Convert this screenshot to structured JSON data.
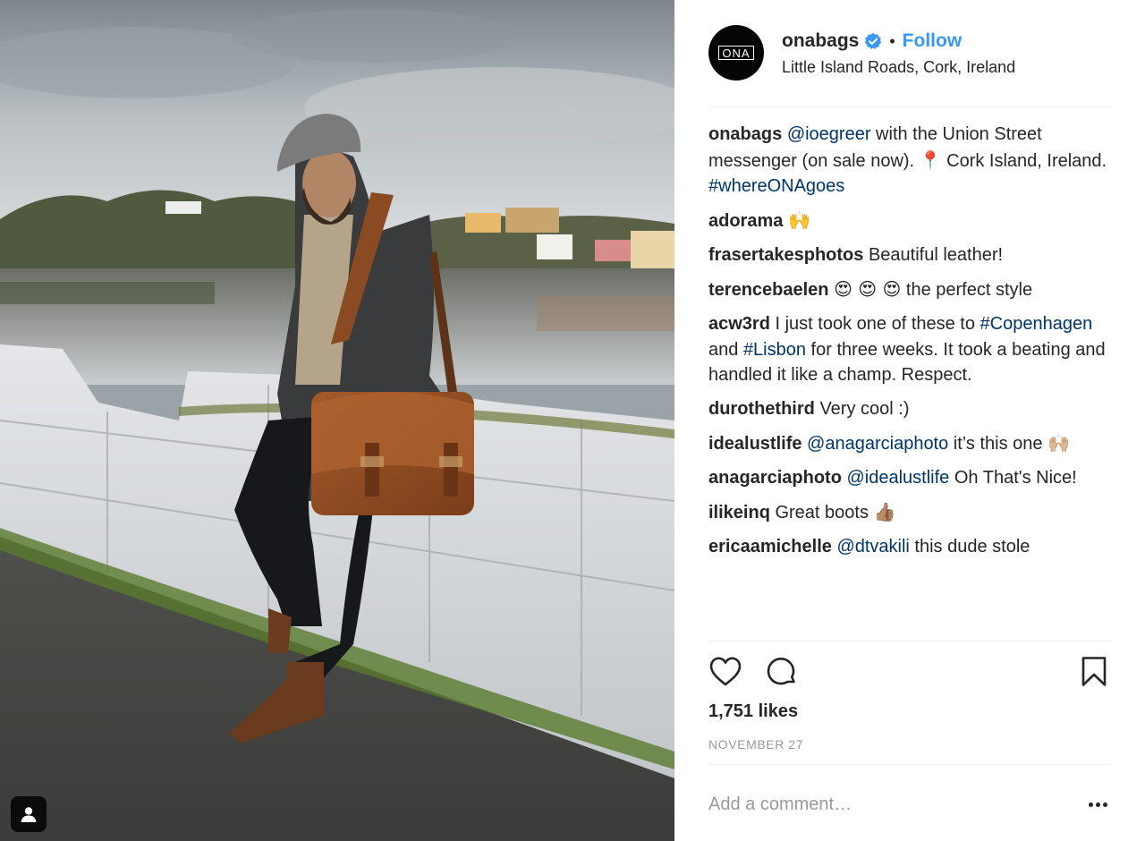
{
  "post": {
    "username": "onabags",
    "avatar_text": "ONA",
    "separator": "•",
    "follow_label": "Follow",
    "location": "Little Island Roads, Cork, Ireland",
    "likes": "1,751 likes",
    "date": "NOVEMBER 27",
    "comment_placeholder": "Add a comment…"
  },
  "caption": {
    "user": "onabags",
    "mention": "@ioegreer",
    "text1": " with the Union Street messenger (on sale now). ",
    "pin": "📍",
    "text2": " Cork Island, Ireland. ",
    "hashtag": "#whereONAgoes"
  },
  "comments": [
    {
      "user": "adorama",
      "emoji": "🙌"
    },
    {
      "user": "frasertakesphotos",
      "text": "Beautiful leather!"
    },
    {
      "user": "terencebaelen",
      "emoji": "😍 😍 😍",
      "text": " the perfect style"
    },
    {
      "user": "acw3rd",
      "text1": "I just took one of these to ",
      "tag1": "#Copenhagen",
      "text2": " and ",
      "tag2": "#Lisbon",
      "text3": " for three weeks. It took a beating and handled it like a champ. Respect."
    },
    {
      "user": "durothethird",
      "text": "Very cool :)"
    },
    {
      "user": "idealustlife",
      "mention": "@anagarciaphoto",
      "text": " it’s this one",
      "emoji": "🙌🏼"
    },
    {
      "user": "anagarciaphoto",
      "mention": "@idealustlife",
      "text": " Oh That's Nice!"
    },
    {
      "user": "ilikeinq",
      "text": "Great boots ",
      "emoji": "👍🏽"
    },
    {
      "user": "ericaamichelle",
      "mention": "@dtvakili",
      "text": " this dude stole"
    }
  ],
  "icons": {
    "verified": "verified-badge-icon",
    "like": "heart-icon",
    "comment": "comment-bubble-icon",
    "save": "bookmark-icon",
    "more": "more-options-icon",
    "tag": "user-tag-icon"
  },
  "colors": {
    "link": "#3897f0",
    "mention": "#003569",
    "text": "#262626",
    "muted": "#999999"
  }
}
